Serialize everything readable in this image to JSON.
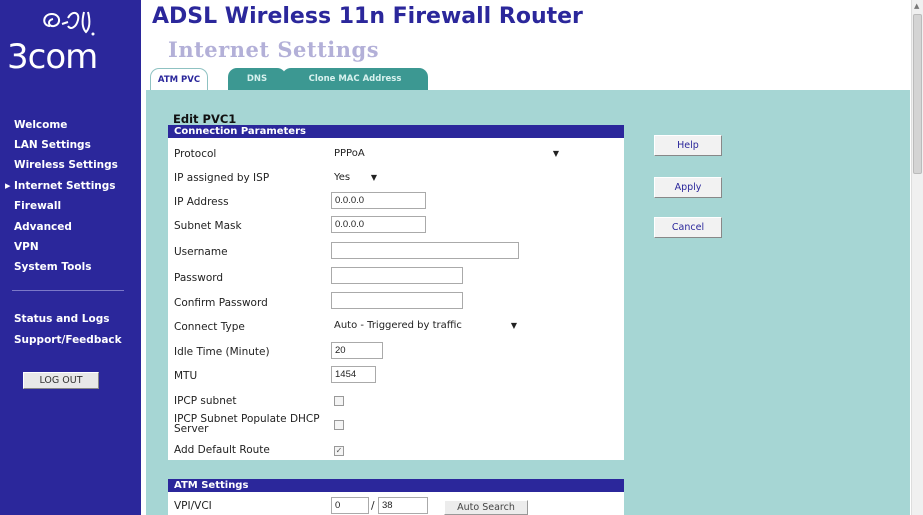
{
  "header": {
    "title": "ADSL Wireless 11n Firewall Router",
    "subtitle": "Internet Settings"
  },
  "logo": {
    "text": "3com"
  },
  "sidebar": {
    "items": [
      {
        "label": "Welcome"
      },
      {
        "label": "LAN Settings"
      },
      {
        "label": "Wireless Settings"
      },
      {
        "label": "Internet Settings",
        "active": true
      },
      {
        "label": "Firewall"
      },
      {
        "label": "Advanced"
      },
      {
        "label": "VPN"
      },
      {
        "label": "System Tools"
      },
      {
        "label": "Status and Logs"
      },
      {
        "label": "Support/Feedback"
      }
    ],
    "logout_label": "LOG OUT"
  },
  "tabs": [
    {
      "label": "ATM PVC",
      "active": true
    },
    {
      "label": "DNS"
    },
    {
      "label": "Clone MAC Address"
    }
  ],
  "edit_title": "Edit PVC1",
  "connection": {
    "section_label": "Connection Parameters",
    "protocol": {
      "label": "Protocol",
      "value": "PPPoA"
    },
    "ip_assigned": {
      "label": "IP assigned by ISP",
      "value": "Yes"
    },
    "ip_address": {
      "label": "IP Address",
      "value": "0.0.0.0"
    },
    "subnet_mask": {
      "label": "Subnet Mask",
      "value": "0.0.0.0"
    },
    "username": {
      "label": "Username",
      "value": ""
    },
    "password": {
      "label": "Password",
      "value": ""
    },
    "confirm_password": {
      "label": "Confirm Password",
      "value": ""
    },
    "connect_type": {
      "label": "Connect Type",
      "value": "Auto - Triggered by traffic"
    },
    "idle_time": {
      "label": "Idle Time (Minute)",
      "value": "20"
    },
    "mtu": {
      "label": "MTU",
      "value": "1454"
    },
    "ipcp_subnet": {
      "label": "IPCP subnet",
      "checked": false
    },
    "ipcp_dhcp": {
      "label": "IPCP Subnet Populate DHCP Server",
      "checked": false
    },
    "default_route": {
      "label": "Add Default Route",
      "checked": true
    }
  },
  "atm": {
    "section_label": "ATM Settings",
    "vpi_vci": {
      "label": "VPI/VCI",
      "vpi": "0",
      "separator": "/",
      "vci": "38"
    },
    "auto_search_label": "Auto Search"
  },
  "buttons": {
    "help": "Help",
    "apply": "Apply",
    "cancel": "Cancel"
  },
  "colors": {
    "sidebar": "#2b279b",
    "content_bg": "#a6d6d4",
    "tab_inactive": "#3c9892",
    "subtitle": "#b3b0d8"
  }
}
